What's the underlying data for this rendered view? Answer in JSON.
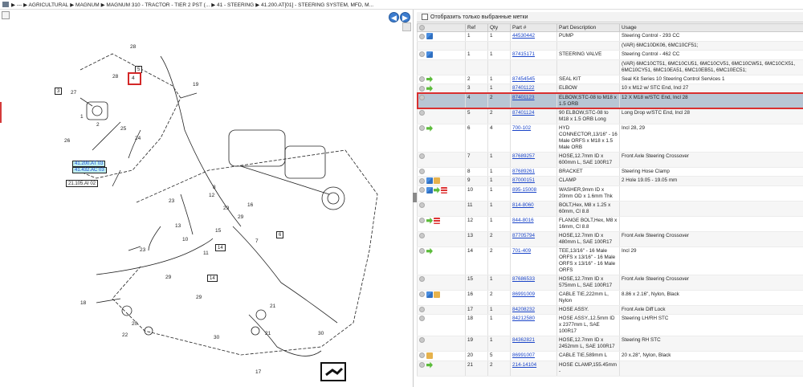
{
  "breadcrumb": {
    "items": [
      "▶ --- ▶ AGRICULTURAL",
      "▶ MAGNUM",
      "▶ MAGNUM 310 - TRACTOR - TIER 2 PST (...",
      "▶ 41 - STEERING",
      "▶ 41.200.AT[01] - STEERING SYSTEM, MFD, M..."
    ]
  },
  "filter": {
    "label": "Отобразить только выбранные метки"
  },
  "table": {
    "headers": [
      "Ref",
      "Qty",
      "Part #",
      "Part Description",
      "Usage"
    ],
    "rows": [
      {
        "ref": "1",
        "qty": "1",
        "part": "44530442",
        "desc": "PUMP",
        "usage": "Steering Control - 293 CC",
        "icons": [
          "swap"
        ]
      },
      {
        "ref": "",
        "qty": "",
        "part": "",
        "desc": "",
        "usage": "(VAR) 6MC10DK06, 6MC10CF51;",
        "icons": []
      },
      {
        "ref": "1",
        "qty": "1",
        "part": "87415171",
        "desc": "STEERING VALVE",
        "usage": "Steering Control - 462 CC",
        "icons": [
          "swap"
        ]
      },
      {
        "ref": "",
        "qty": "",
        "part": "",
        "desc": "",
        "usage": "(VAR) 6MC10CT51, 6MC10CU51, 6MC10CV51, 6MC10CW51, 6MC10CX51, 6MC10CY51, 6MC10EA51, 6MC10EB51, 6MC10EC51;",
        "icons": []
      },
      {
        "ref": "2",
        "qty": "1",
        "part": "87454545",
        "desc": "SEAL KIT",
        "usage": "Seal Kit Series 10 Steering Control Services 1",
        "icons": [
          "arrow"
        ]
      },
      {
        "ref": "3",
        "qty": "1",
        "part": "87401122",
        "desc": "ELBOW",
        "usage": "10 x M12 w/ STC End, Incl 27",
        "icons": [
          "arrow"
        ]
      },
      {
        "ref": "4",
        "qty": "2",
        "part": "87401123",
        "desc": "ELBOW,STC-08 to M18 x 1.5 ORB",
        "usage": "12 X M18 w/STC End, Incl 28",
        "icons": [],
        "selected": true
      },
      {
        "ref": "5",
        "qty": "2",
        "part": "87401124",
        "desc": "90 ELBOW,STC-08 to M18 x 1.5 ORB Long",
        "usage": "Long Drop w/STC End, Incl 28",
        "icons": []
      },
      {
        "ref": "6",
        "qty": "4",
        "part": "700-102",
        "desc": "HYD CONNECTOR,13/16\" - 16 Male ORFS x M18 x 1.5 Male ORB",
        "usage": "Incl 28, 29",
        "icons": [
          "arrow"
        ]
      },
      {
        "ref": "7",
        "qty": "1",
        "part": "87689257",
        "desc": "HOSE,12.7mm ID x 600mm L, SAE 100R17",
        "usage": "Front Axle Steering Crossover",
        "icons": []
      },
      {
        "ref": "8",
        "qty": "1",
        "part": "87689261",
        "desc": "BRACKET",
        "usage": "Steering Hose Clamp",
        "icons": []
      },
      {
        "ref": "9",
        "qty": "1",
        "part": "87000151",
        "desc": "CLAMP",
        "usage": "2 Hole 19.05 - 19.05 mm",
        "icons": [
          "swap",
          "box"
        ]
      },
      {
        "ref": "10",
        "qty": "1",
        "part": "895-15008",
        "desc": "WASHER,9mm ID x 20mm OD x 1.6mm Thk",
        "usage": "",
        "icons": [
          "swap",
          "arrow",
          "flag"
        ]
      },
      {
        "ref": "11",
        "qty": "1",
        "part": "814-8060",
        "desc": "BOLT,Hex, M8 x 1.25 x 60mm, Cl 8.8",
        "usage": "",
        "icons": []
      },
      {
        "ref": "12",
        "qty": "1",
        "part": "844-8016",
        "desc": "FLANGE BOLT,Hex, M8 x 16mm, Cl 8.8",
        "usage": "",
        "icons": [
          "arrow",
          "flag"
        ]
      },
      {
        "ref": "13",
        "qty": "2",
        "part": "87705794",
        "desc": "HOSE,12.7mm ID x 480mm L, SAE 100R17",
        "usage": "Front Axle Steering Crossover",
        "icons": []
      },
      {
        "ref": "14",
        "qty": "2",
        "part": "701-409",
        "desc": "TEE,13/16\" - 16 Male ORFS x 13/16\" - 16 Male ORFS x 13/16\" - 16 Male ORFS",
        "usage": "Incl 29",
        "icons": [
          "arrow"
        ]
      },
      {
        "ref": "15",
        "qty": "1",
        "part": "87686533",
        "desc": "HOSE,12.7mm ID x 575mm L, SAE 100R17",
        "usage": "Front Axle Steering Crossover",
        "icons": []
      },
      {
        "ref": "16",
        "qty": "2",
        "part": "86991009",
        "desc": "CABLE TIE,222mm L, Nylon",
        "usage": "8.86 x 2.16\", Nylon, Black",
        "icons": [
          "swap",
          "box"
        ]
      },
      {
        "ref": "17",
        "qty": "1",
        "part": "84208232",
        "desc": "HOSE ASSY.",
        "usage": "Front Axle Diff Lock",
        "icons": []
      },
      {
        "ref": "18",
        "qty": "1",
        "part": "84212580",
        "desc": "HOSE ASSY.,12.5mm ID x 2377mm L, SAE 100R17",
        "usage": "Steering LH/RH STC",
        "icons": []
      },
      {
        "ref": "19",
        "qty": "1",
        "part": "84362821",
        "desc": "HOSE,12.7mm ID x 2452mm L, SAE 100R17",
        "usage": "Steering RH STC",
        "icons": []
      },
      {
        "ref": "20",
        "qty": "5",
        "part": "86991007",
        "desc": "CABLE TIE,589mm L",
        "usage": "20 x.28\", Nylon, Black",
        "icons": [
          "box"
        ]
      },
      {
        "ref": "21",
        "qty": "2",
        "part": "214-14104",
        "desc": "HOSE CLAMP,155.45mm -",
        "usage": "",
        "icons": [
          "arrow"
        ]
      }
    ]
  },
  "diagram": {
    "callouts": [
      "28",
      "5",
      "4",
      "28",
      "3",
      "27",
      "1",
      "2",
      "25",
      "24",
      "26",
      "19",
      "21",
      "8",
      "12",
      "6",
      "23",
      "29",
      "16",
      "13",
      "29",
      "9",
      "10",
      "15",
      "11",
      "6",
      "7",
      "23",
      "14",
      "29",
      "14",
      "22",
      "18",
      "29",
      "21",
      "20",
      "22",
      "30",
      "30",
      "17",
      "21"
    ],
    "boxed_labels": [
      "5",
      "3",
      "6",
      "14",
      "7",
      "14"
    ],
    "refs": [
      "41.200.AT 03",
      "41.432.AC 03",
      "21.105.AI 02"
    ]
  }
}
